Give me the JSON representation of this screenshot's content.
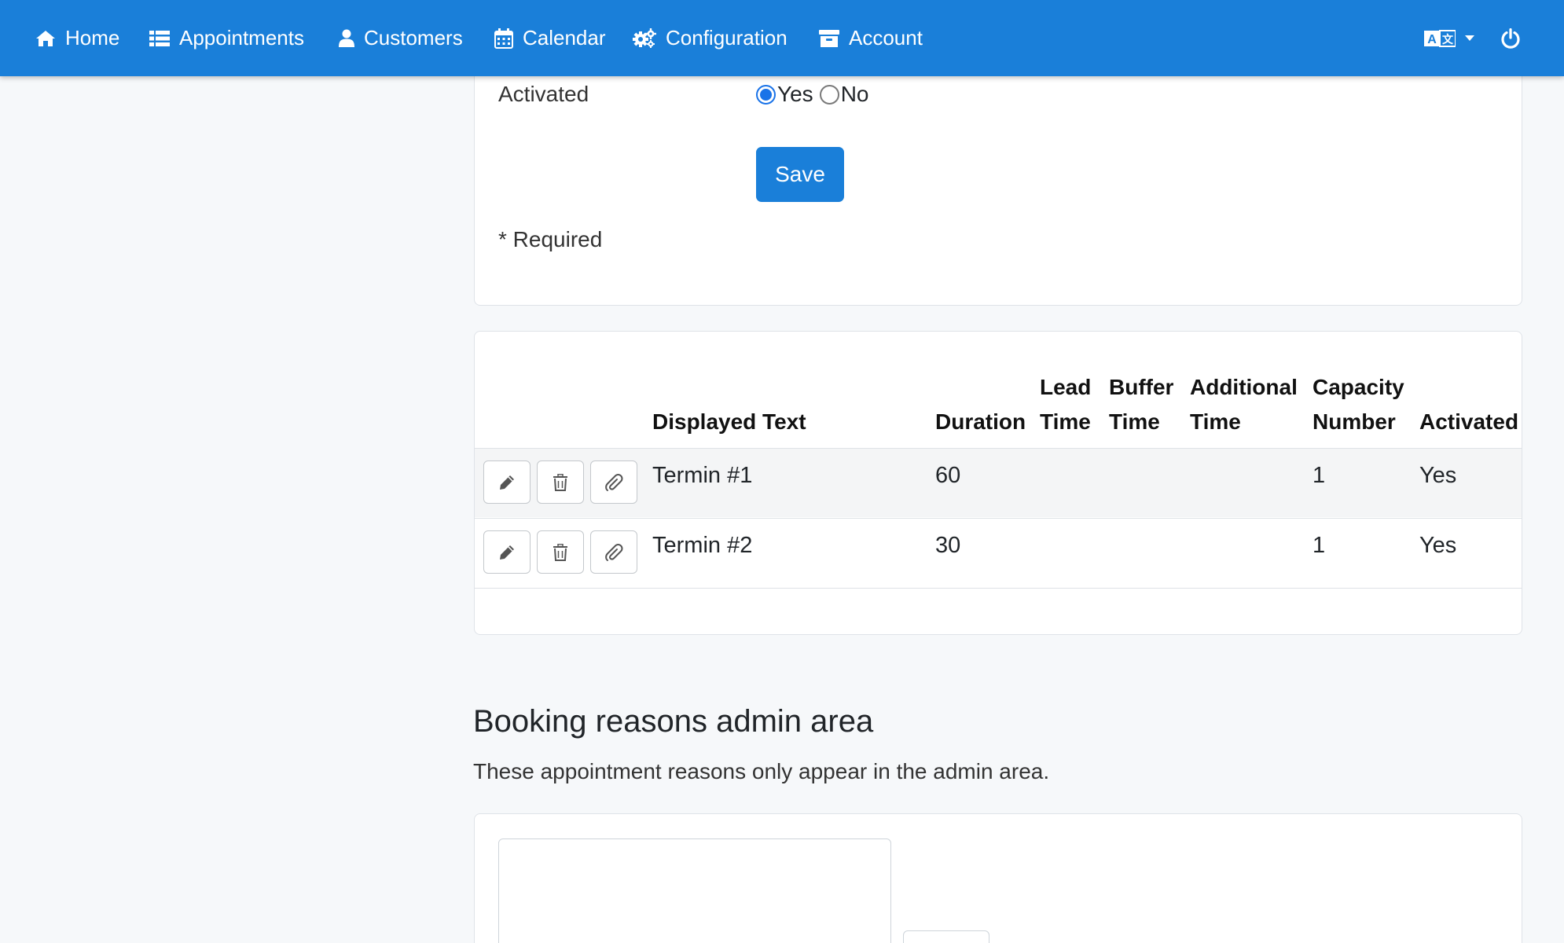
{
  "nav": {
    "items": [
      {
        "label": "Home",
        "icon": "home-icon"
      },
      {
        "label": "Appointments",
        "icon": "list-icon"
      },
      {
        "label": "Customers",
        "icon": "user-icon"
      },
      {
        "label": "Calendar",
        "icon": "calendar-icon"
      },
      {
        "label": "Configuration",
        "icon": "gears-icon"
      },
      {
        "label": "Account",
        "icon": "archive-icon"
      }
    ],
    "language_icon": "language-icon",
    "power_icon": "power-icon"
  },
  "form": {
    "activated_label": "Activated",
    "yes_label": "Yes",
    "no_label": "No",
    "activated_value": "Yes",
    "save_label": "Save",
    "required_note": "* Required"
  },
  "table": {
    "headers": {
      "displayed_text": "Displayed Text",
      "duration": "Duration",
      "lead_time": [
        "Lead",
        "Time"
      ],
      "buffer_time": [
        "Buffer",
        "Time"
      ],
      "additional_time": [
        "Additional",
        "Time"
      ],
      "capacity_number": [
        "Capacity",
        "Number"
      ],
      "activated": "Activated"
    },
    "rows": [
      {
        "text": "Termin #1",
        "duration": "60",
        "lead": "",
        "buffer": "",
        "additional": "",
        "capacity": "1",
        "activated": "Yes"
      },
      {
        "text": "Termin #2",
        "duration": "30",
        "lead": "",
        "buffer": "",
        "additional": "",
        "capacity": "1",
        "activated": "Yes"
      }
    ]
  },
  "booking_reasons": {
    "title": "Booking reasons admin area",
    "description": "These appointment reasons only appear in the admin area."
  },
  "colors": {
    "navbar": "#1a7fd9",
    "primary_button": "#1a7fd9",
    "radio_checked": "#1a73e8",
    "page_background": "#f6f8fa"
  }
}
